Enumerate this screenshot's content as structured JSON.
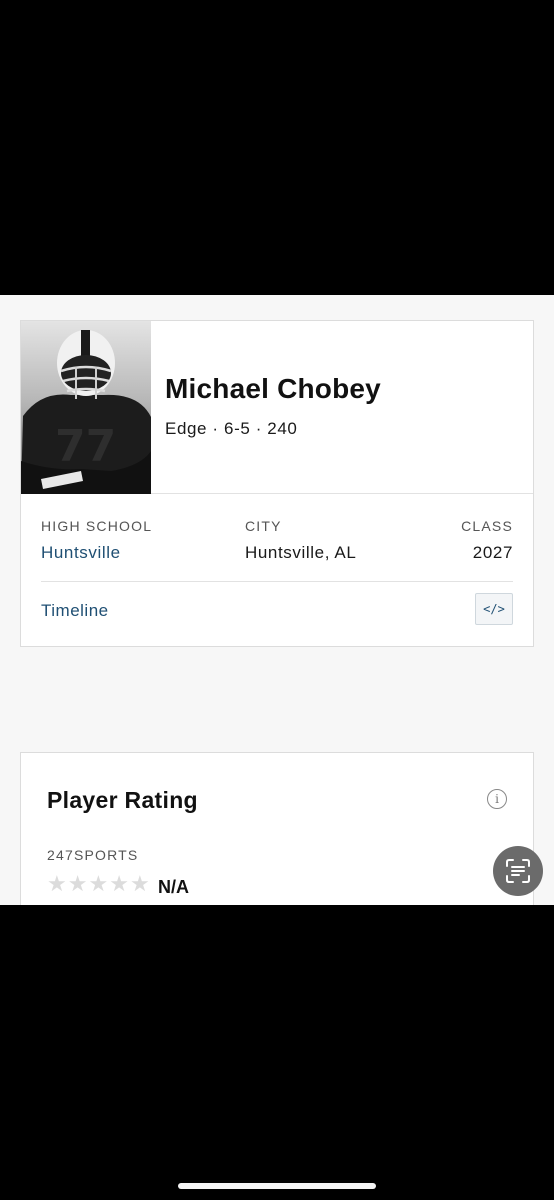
{
  "player": {
    "name": "Michael Chobey",
    "meta": "Edge · 6-5 · 240",
    "jersey_number": "77"
  },
  "details": {
    "high_school_label": "HIGH SCHOOL",
    "high_school_value": "Huntsville",
    "city_label": "CITY",
    "city_value": "Huntsville, AL",
    "class_label": "CLASS",
    "class_value": "2027"
  },
  "links": {
    "timeline": "Timeline",
    "embed_symbol": "</>"
  },
  "rating": {
    "title": "Player Rating",
    "info_symbol": "i",
    "source_label": "247SPORTS",
    "star_count": 5,
    "filled_stars": 0,
    "value": "N/A"
  },
  "colors": {
    "link_blue": "#1f4f73",
    "empty_star": "#dcdcdc"
  },
  "icons": {
    "info": "info-icon",
    "embed": "code-embed-icon",
    "scan": "text-scan-icon"
  }
}
